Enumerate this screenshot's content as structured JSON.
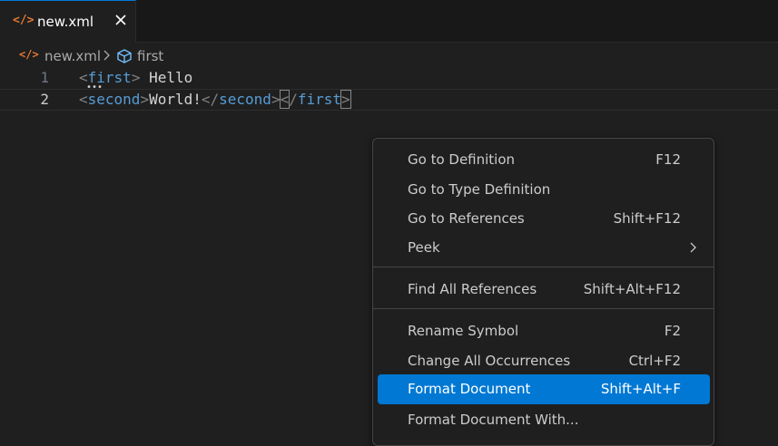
{
  "tab": {
    "label": "new.xml",
    "icon": "xml-file-icon"
  },
  "breadcrumb": {
    "file": "new.xml",
    "symbol": "first"
  },
  "editor": {
    "lines": [
      {
        "number": "1",
        "open_tag": "first",
        "text": " Hello"
      },
      {
        "number": "2",
        "open_tag": "second",
        "text": "World!",
        "close_tag": "second",
        "close_outer": "first"
      }
    ]
  },
  "context_menu": {
    "items": [
      {
        "label": "Go to Definition",
        "shortcut": "F12"
      },
      {
        "label": "Go to Type Definition",
        "shortcut": ""
      },
      {
        "label": "Go to References",
        "shortcut": "Shift+F12"
      },
      {
        "label": "Peek",
        "shortcut": "",
        "submenu": true
      },
      {
        "label": "Find All References",
        "shortcut": "Shift+Alt+F12"
      },
      {
        "label": "Rename Symbol",
        "shortcut": "F2"
      },
      {
        "label": "Change All Occurrences",
        "shortcut": "Ctrl+F2"
      },
      {
        "label": "Format Document",
        "shortcut": "Shift+Alt+F",
        "selected": true
      },
      {
        "label": "Format Document With...",
        "shortcut": ""
      }
    ]
  },
  "colors": {
    "accent": "#0078d4",
    "tag": "#569cd6",
    "bracket": "#808080",
    "xml_icon": "#e37933"
  }
}
